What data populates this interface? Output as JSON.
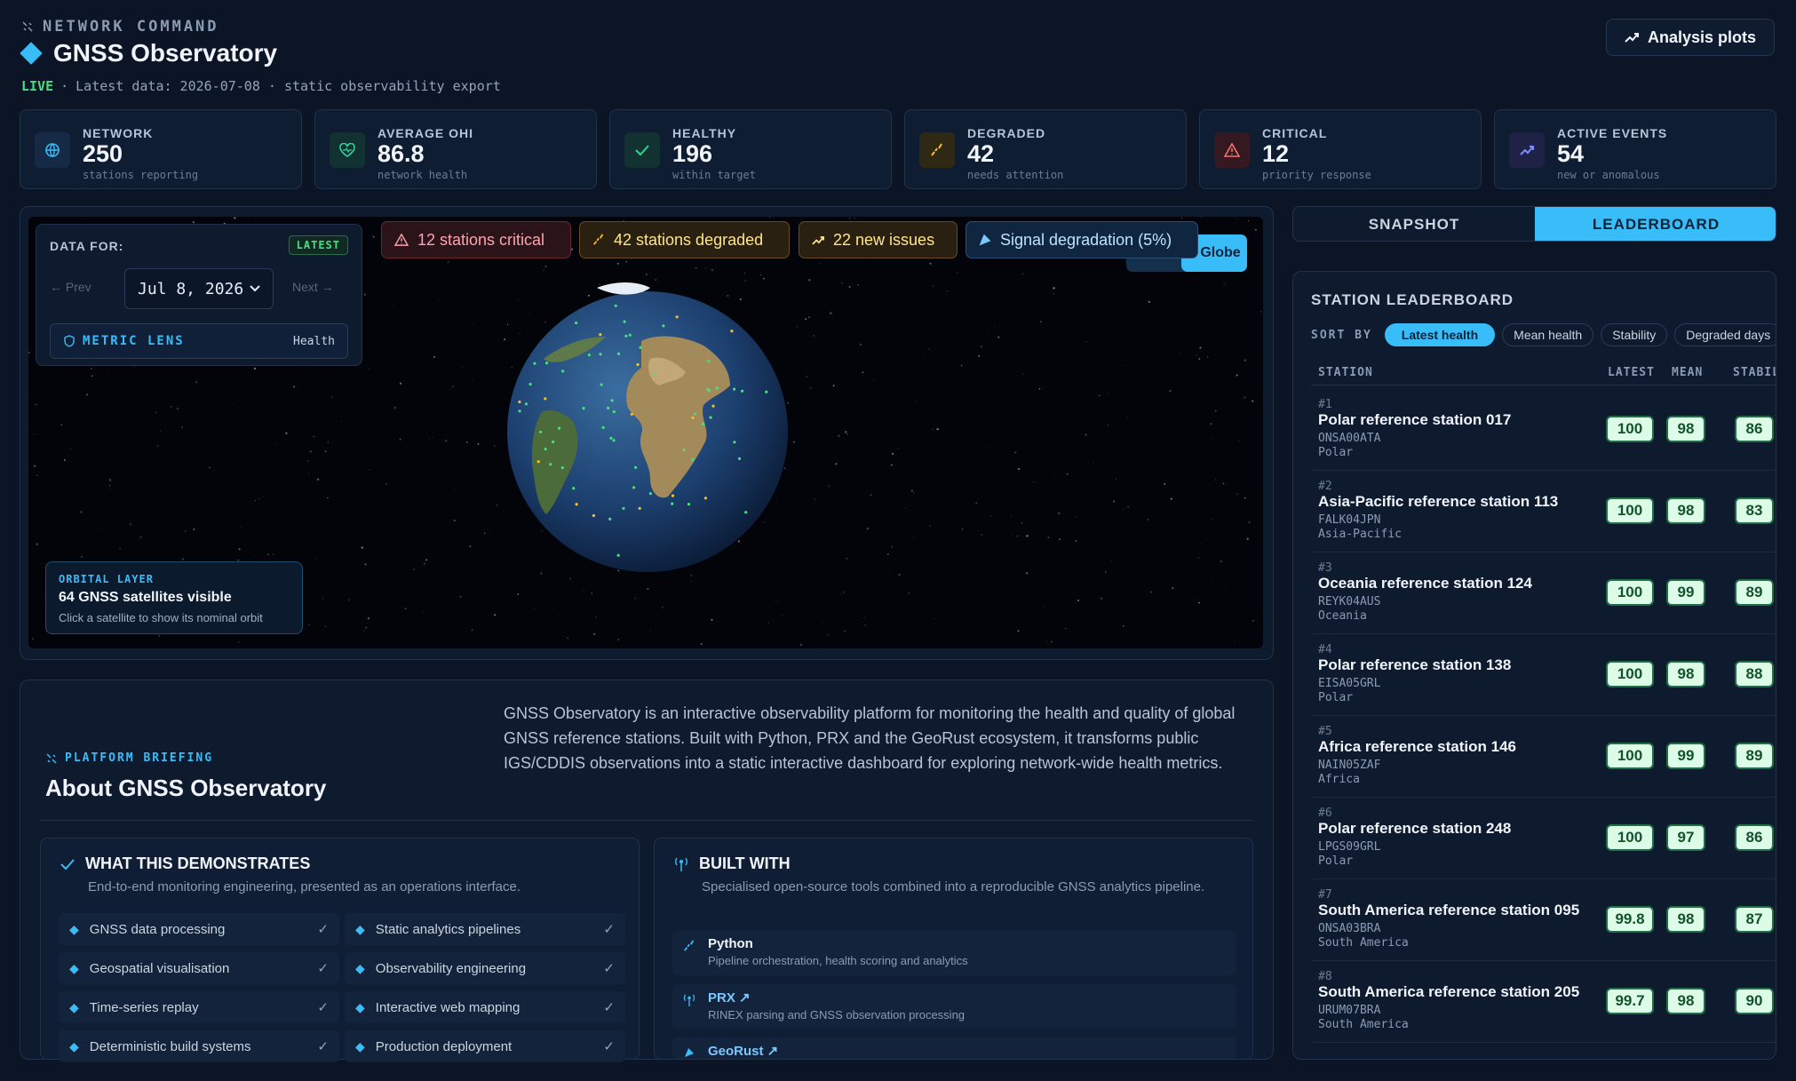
{
  "header": {
    "kicker": "NETWORK COMMAND",
    "title": "GNSS Observatory",
    "live": "LIVE",
    "subtitle": "Latest data: 2026-07-08 · static observability export",
    "plots_button": "Analysis plots"
  },
  "kpis": [
    {
      "label": "NETWORK",
      "value": "250",
      "sub": "stations reporting",
      "icon": "globe-icon",
      "color": "#38bdf8"
    },
    {
      "label": "AVERAGE OHI",
      "value": "86.8",
      "sub": "network health",
      "icon": "heart-icon",
      "color": "#34d399"
    },
    {
      "label": "HEALTHY",
      "value": "196",
      "sub": "within target",
      "icon": "check-icon",
      "color": "#34d399"
    },
    {
      "label": "DEGRADED",
      "value": "42",
      "sub": "needs attention",
      "icon": "activity-icon",
      "color": "#fbbf24"
    },
    {
      "label": "CRITICAL",
      "value": "12",
      "sub": "priority response",
      "icon": "warning-icon",
      "color": "#f87171"
    },
    {
      "label": "ACTIVE EVENTS",
      "value": "54",
      "sub": "new or anomalous",
      "icon": "trend-icon",
      "color": "#818cf8"
    }
  ],
  "data_for": {
    "label": "DATA FOR:",
    "badge": "LATEST",
    "prev": "← Prev",
    "date": "Jul 8, 2026",
    "next": "Next →",
    "lens_label": "METRIC LENS",
    "lens_value": "Health"
  },
  "alerts": {
    "critical": "12 stations critical",
    "degraded": "42 stations degraded",
    "new_issues": "22 new issues",
    "signal": "Signal degradation (5%)"
  },
  "globe_button": "Globe",
  "orbital": {
    "kicker": "ORBITAL LAYER",
    "title": "64 GNSS satellites visible",
    "hint": "Click a satellite to show its nominal orbit"
  },
  "about": {
    "kicker": "PLATFORM BRIEFING",
    "title": "About GNSS Observatory",
    "description": "GNSS Observatory is an interactive observability platform for monitoring the health and quality of global GNSS reference stations. Built with Python, PRX and the GeoRust ecosystem, it transforms public IGS/CDDIS observations into a static interactive dashboard for exploring network-wide health metrics.",
    "demo_title": "WHAT THIS DEMONSTRATES",
    "demo_sub": "End-to-end monitoring engineering, presented as an operations interface.",
    "demo_items": [
      "GNSS data processing",
      "Static analytics pipelines",
      "Geospatial visualisation",
      "Observability engineering",
      "Time-series replay",
      "Interactive web mapping",
      "Deterministic build systems",
      "Production deployment"
    ],
    "built_title": "BUILT WITH",
    "built_sub": "Specialised open-source tools combined into a reproducible GNSS analytics pipeline.",
    "tools": [
      {
        "name": "Python",
        "desc": "Pipeline orchestration, health scoring and analytics"
      },
      {
        "name": "PRX ↗",
        "desc": "RINEX parsing and GNSS observation processing"
      },
      {
        "name": "GeoRust ↗",
        "desc": ""
      }
    ]
  },
  "sidebar": {
    "tab_snapshot": "SNAPSHOT",
    "tab_leaderboard": "LEADERBOARD",
    "title": "STATION LEADERBOARD",
    "sort_label": "SORT BY",
    "sort_options": [
      "Latest health",
      "Mean health",
      "Stability",
      "Degraded days"
    ],
    "columns": [
      "STATION",
      "LATEST",
      "MEAN",
      "STABILI"
    ],
    "rows": [
      {
        "rank": "#1",
        "name": "Polar reference station 017",
        "code": "ONSA00ATA",
        "region": "Polar",
        "latest": "100",
        "mean": "98",
        "stability": "86"
      },
      {
        "rank": "#2",
        "name": "Asia-Pacific reference station 113",
        "code": "FALK04JPN",
        "region": "Asia-Pacific",
        "latest": "100",
        "mean": "98",
        "stability": "83"
      },
      {
        "rank": "#3",
        "name": "Oceania reference station 124",
        "code": "REYK04AUS",
        "region": "Oceania",
        "latest": "100",
        "mean": "99",
        "stability": "89"
      },
      {
        "rank": "#4",
        "name": "Polar reference station 138",
        "code": "EISA05GRL",
        "region": "Polar",
        "latest": "100",
        "mean": "98",
        "stability": "88"
      },
      {
        "rank": "#5",
        "name": "Africa reference station 146",
        "code": "NAIN05ZAF",
        "region": "Africa",
        "latest": "100",
        "mean": "99",
        "stability": "89"
      },
      {
        "rank": "#6",
        "name": "Polar reference station 248",
        "code": "LPGS09GRL",
        "region": "Polar",
        "latest": "100",
        "mean": "97",
        "stability": "86"
      },
      {
        "rank": "#7",
        "name": "South America reference station 095",
        "code": "ONSA03BRA",
        "region": "South America",
        "latest": "99.8",
        "mean": "98",
        "stability": "87"
      },
      {
        "rank": "#8",
        "name": "South America reference station 205",
        "code": "URUM07BRA",
        "region": "South America",
        "latest": "99.7",
        "mean": "98",
        "stability": "90"
      }
    ]
  }
}
